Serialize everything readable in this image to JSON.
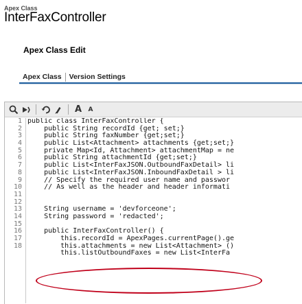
{
  "header": {
    "small_label": "Apex Class",
    "title": "InterFaxController"
  },
  "section": {
    "title": "Apex Class Edit"
  },
  "tabs": [
    {
      "label": "Apex Class"
    },
    {
      "label": "Version Settings"
    }
  ],
  "toolbar": {
    "buttons": [
      {
        "icon": "search-icon"
      },
      {
        "icon": "goto-line-icon"
      },
      {
        "icon": "undo-icon"
      },
      {
        "icon": "redo-icon"
      },
      {
        "icon": "increase-font-icon",
        "label": "A"
      },
      {
        "icon": "decrease-font-icon",
        "label": "A"
      }
    ]
  },
  "editor": {
    "line_numbers": [
      "1",
      "2",
      "3",
      "4",
      "5",
      "6",
      "7",
      "8",
      "9",
      "10",
      "11",
      "12",
      "13",
      "14",
      "15",
      "16",
      "17",
      "18"
    ],
    "lines": [
      "public class InterFaxController {",
      "    public String recordId {get; set;}",
      "    public String faxNumber {get;set;}",
      "    public List<Attachment> attachments {get;set;}",
      "    private Map<Id, Attachment> attachmentMap = ne",
      "    public String attachmentId {get;set;}",
      "    public List<InterFaxJSON.OutboundFaxDetail> li",
      "    public List<InterFaxJSON.InboundFaxDetail > li",
      "    // Specify the required user name and passwor",
      "    // As well as the header and header informati",
      "",
      "",
      "    String username = 'devforceone';",
      "    String password = 'redacted';",
      "",
      "    public InterFaxController() {",
      "        this.recordId = ApexPages.currentPage().ge",
      "        this.attachments = new List<Attachment> ()",
      "        this.listOutboundFaxes = new List<InterFa"
    ]
  },
  "colors": {
    "tab_rule": "#1f5f9f",
    "highlight": "#c0001a"
  }
}
